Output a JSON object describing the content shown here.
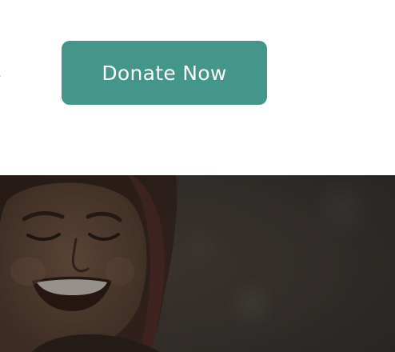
{
  "header": {
    "nav_fragment": "s",
    "donate_label": "Donate Now"
  },
  "hero": {
    "image_icon": "smiling-girl-photo"
  },
  "colors": {
    "accent": "#45968a",
    "button_text": "#ffffff",
    "hero_overlay": "#2e2b29"
  }
}
